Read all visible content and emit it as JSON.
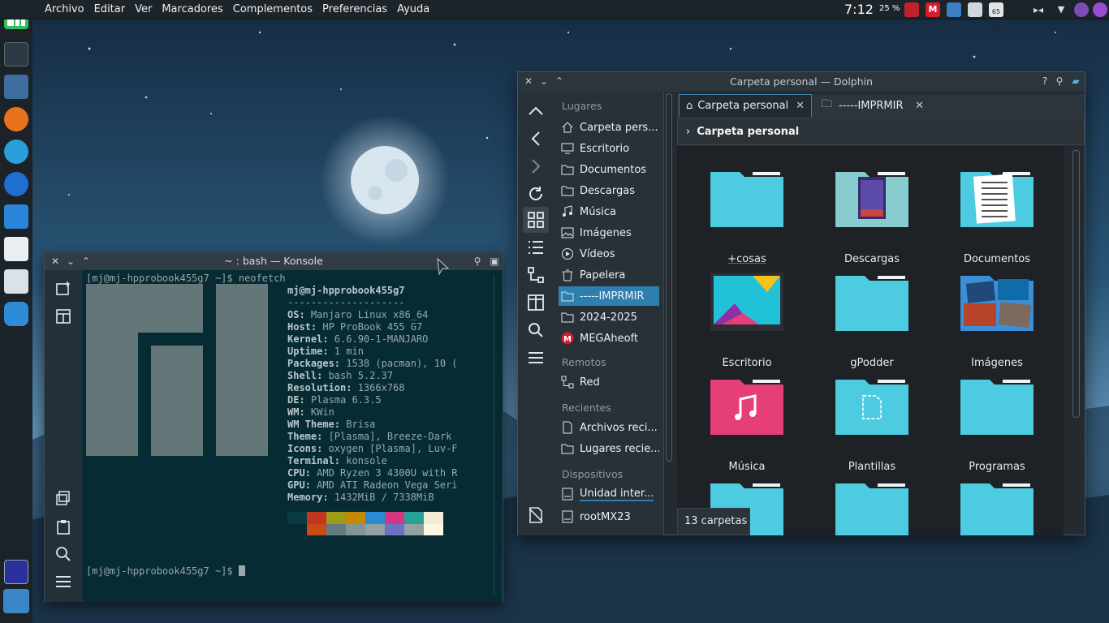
{
  "menubar": [
    "Archivo",
    "Editar",
    "Ver",
    "Marcadores",
    "Complementos",
    "Preferencias",
    "Ayuda"
  ],
  "tray": {
    "clock": "7:12",
    "battery": "25 %",
    "battery_small": "65 %"
  },
  "konsole": {
    "title": "~ : bash — Konsole",
    "prompt1": "[mj@mj-hpprobook455g7 ~]$ ",
    "command": "neofetch",
    "userhost": "mj@mj-hpprobook455g7",
    "separator": "--------------------",
    "info": [
      {
        "label": "OS: ",
        "value": "Manjaro Linux x86_64"
      },
      {
        "label": "Host: ",
        "value": "HP ProBook 455 G7"
      },
      {
        "label": "Kernel: ",
        "value": "6.6.90-1-MANJARO"
      },
      {
        "label": "Uptime: ",
        "value": "1 min"
      },
      {
        "label": "Packages: ",
        "value": "1538 (pacman), 10 ("
      },
      {
        "label": "Shell: ",
        "value": "bash 5.2.37"
      },
      {
        "label": "Resolution: ",
        "value": "1366x768"
      },
      {
        "label": "DE: ",
        "value": "Plasma 6.3.5"
      },
      {
        "label": "WM: ",
        "value": "KWin"
      },
      {
        "label": "WM Theme: ",
        "value": "Brisa"
      },
      {
        "label": "Theme: ",
        "value": "[Plasma], Breeze-Dark"
      },
      {
        "label": "Icons: ",
        "value": "oxygen [Plasma], Luv-F"
      },
      {
        "label": "Terminal: ",
        "value": "konsole"
      },
      {
        "label": "CPU: ",
        "value": "AMD Ryzen 3 4300U with R"
      },
      {
        "label": "GPU: ",
        "value": "AMD ATI Radeon Vega Seri"
      },
      {
        "label": "Memory: ",
        "value": "1432MiB / 7338MiB"
      }
    ],
    "prompt2": "[mj@mj-hpprobook455g7 ~]$ ",
    "palette_top": [
      "#0a3b44",
      "#c23621",
      "#9c9c1a",
      "#c68a00",
      "#2a8ad3",
      "#d33682",
      "#2aa198",
      "#f3ecd7"
    ],
    "palette_bottom": [
      "#c84b16",
      "#657b83",
      "#839496",
      "#93a1a1",
      "#6c71c4",
      "#93a1a1",
      "#fdf6e3"
    ]
  },
  "dolphin": {
    "title": "Carpeta personal — Dolphin",
    "tabs": [
      "Carpeta personal",
      "-----IMPRMIR"
    ],
    "breadcrumb": "Carpeta personal",
    "status": "13 carpetas",
    "places_sections": {
      "lugares": "Lugares",
      "remotos": "Remotos",
      "recientes": "Recientes",
      "dispositivos": "Dispositivos"
    },
    "places": [
      {
        "label": "Carpeta pers...",
        "icon": "home-icon"
      },
      {
        "label": "Escritorio",
        "icon": "desktop-icon"
      },
      {
        "label": "Documentos",
        "icon": "documents-icon"
      },
      {
        "label": "Descargas",
        "icon": "folder-icon"
      },
      {
        "label": "Música",
        "icon": "music-icon"
      },
      {
        "label": "Imágenes",
        "icon": "image-icon"
      },
      {
        "label": "Vídeos",
        "icon": "video-icon"
      },
      {
        "label": "Papelera",
        "icon": "trash-icon"
      },
      {
        "label": "-----IMPRMIR",
        "icon": "folder-icon"
      },
      {
        "label": "2024-2025",
        "icon": "folder-icon"
      },
      {
        "label": "MEGAheoft",
        "icon": "mega-icon"
      }
    ],
    "remote": [
      {
        "label": "Red",
        "icon": "network-icon"
      }
    ],
    "recent": [
      {
        "label": "Archivos reci...",
        "icon": "recent-files-icon"
      },
      {
        "label": "Lugares recie...",
        "icon": "recent-places-icon"
      }
    ],
    "devices": [
      {
        "label": "Unidad inter...",
        "icon": "drive-icon"
      },
      {
        "label": "rootMX23",
        "icon": "drive-icon"
      }
    ],
    "folders": [
      {
        "label": "+cosas",
        "kind": "plain"
      },
      {
        "label": "Descargas",
        "kind": "poster"
      },
      {
        "label": "Documentos",
        "kind": "doc"
      },
      {
        "label": "Escritorio",
        "kind": "desktop"
      },
      {
        "label": "gPodder",
        "kind": "plain"
      },
      {
        "label": "Imágenes",
        "kind": "images"
      },
      {
        "label": "Música",
        "kind": "music"
      },
      {
        "label": "Plantillas",
        "kind": "template"
      },
      {
        "label": "Programas",
        "kind": "plain"
      },
      {
        "label": "",
        "kind": "plain"
      },
      {
        "label": "",
        "kind": "plain"
      },
      {
        "label": "",
        "kind": "plain"
      }
    ]
  },
  "colors": {
    "accent": "#2d7fb0",
    "folder": "#4dcbe0",
    "music_folder": "#e63e77",
    "terminal_bg": "#072b33"
  }
}
